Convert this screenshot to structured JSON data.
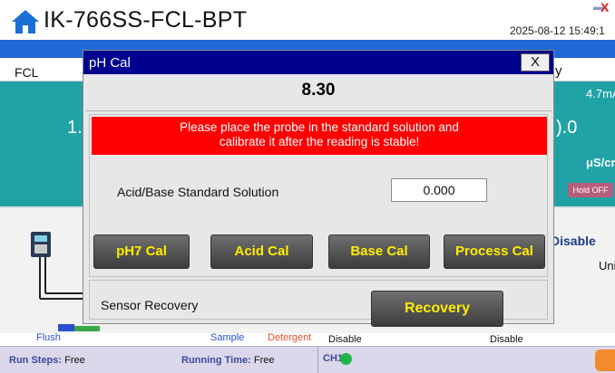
{
  "window": {
    "title": "IK-766SS-FCL-BPT",
    "datetime": "2025-08-12 15:49:1",
    "close_glyph": "X"
  },
  "background": {
    "tab_label": "FCL",
    "tab_right_fragment": "y",
    "left_value_fragment": "1.",
    "right_value_fragment": ").0",
    "rate_fragment": "4.7mA",
    "unit_fragment": "μS/cr",
    "hold_off": "Hold OFF",
    "right_disable": "Disable",
    "right_uni": "Uni",
    "flush": "Flush",
    "sample": "Sample",
    "detergent": "Detergent",
    "disable_a": "Disable",
    "disable_b": "Disable"
  },
  "status_bar": {
    "run_steps_label": "Run Steps:",
    "run_steps_value": "Free",
    "running_time_label": "Running Time:",
    "running_time_value": "Free",
    "ch1_label": "CH1:"
  },
  "dialog": {
    "title": "pH Cal",
    "close_label": "X",
    "reading": "8.30",
    "warning_line1": "Please place the probe in the standard solution and",
    "warning_line2": "calibrate it after the reading is stable!",
    "standard_label": "Acid/Base Standard Solution",
    "standard_value": "0.000",
    "buttons": {
      "ph7": "pH7 Cal",
      "acid": "Acid Cal",
      "base": "Base Cal",
      "process": "Process Cal"
    },
    "sensor_recovery_label": "Sensor Recovery",
    "recovery_button": "Recovery"
  },
  "colors": {
    "dialog_title_bg": "#010190",
    "warning_bg": "#fe0000",
    "button_text": "#ffec00",
    "teal_panel": "#21a3a6",
    "status_ok": "#20b34a"
  },
  "icons": [
    "home-icon",
    "minimize-icon",
    "close-icon",
    "device-icon",
    "trend-icon",
    "status-dot-icon"
  ]
}
